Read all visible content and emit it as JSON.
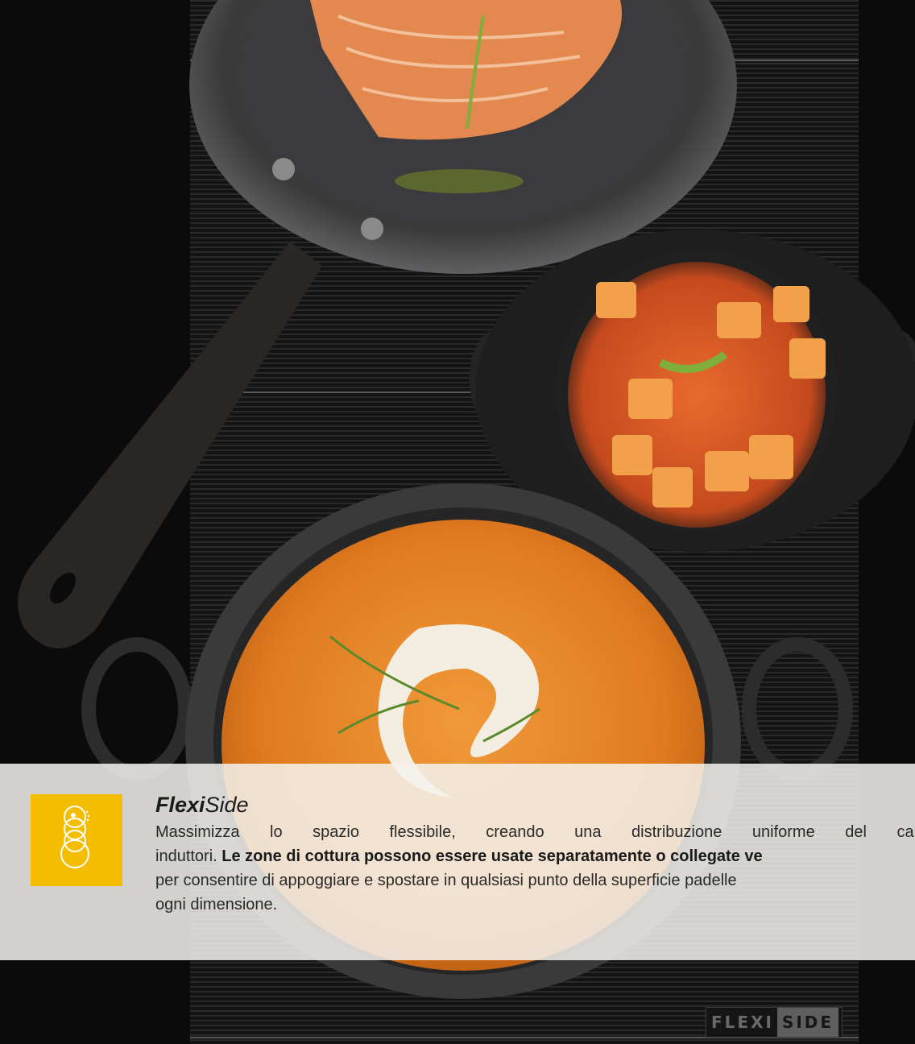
{
  "feature": {
    "title_bold": "Flexi",
    "title_light": "Side",
    "line1": "Massimizza lo spazio flessibile, creando una distribuzione uniforme del calore",
    "line2_start": "induttori.",
    "line2_bold": "Le zone di cottura possono essere usate separatamente o collegate ve",
    "line3": "per consentire di appoggiare e spostare in qualsiasi punto della superficie padelle",
    "line4": "ogni dimensione."
  },
  "logo": {
    "part1": "FLEXI",
    "part2": "SIDE"
  },
  "colors": {
    "badge": "#f5bd00",
    "background": "#0b0b0b",
    "panel": "#f4f2ee"
  },
  "icons": [
    "flexi-zones-icon"
  ]
}
